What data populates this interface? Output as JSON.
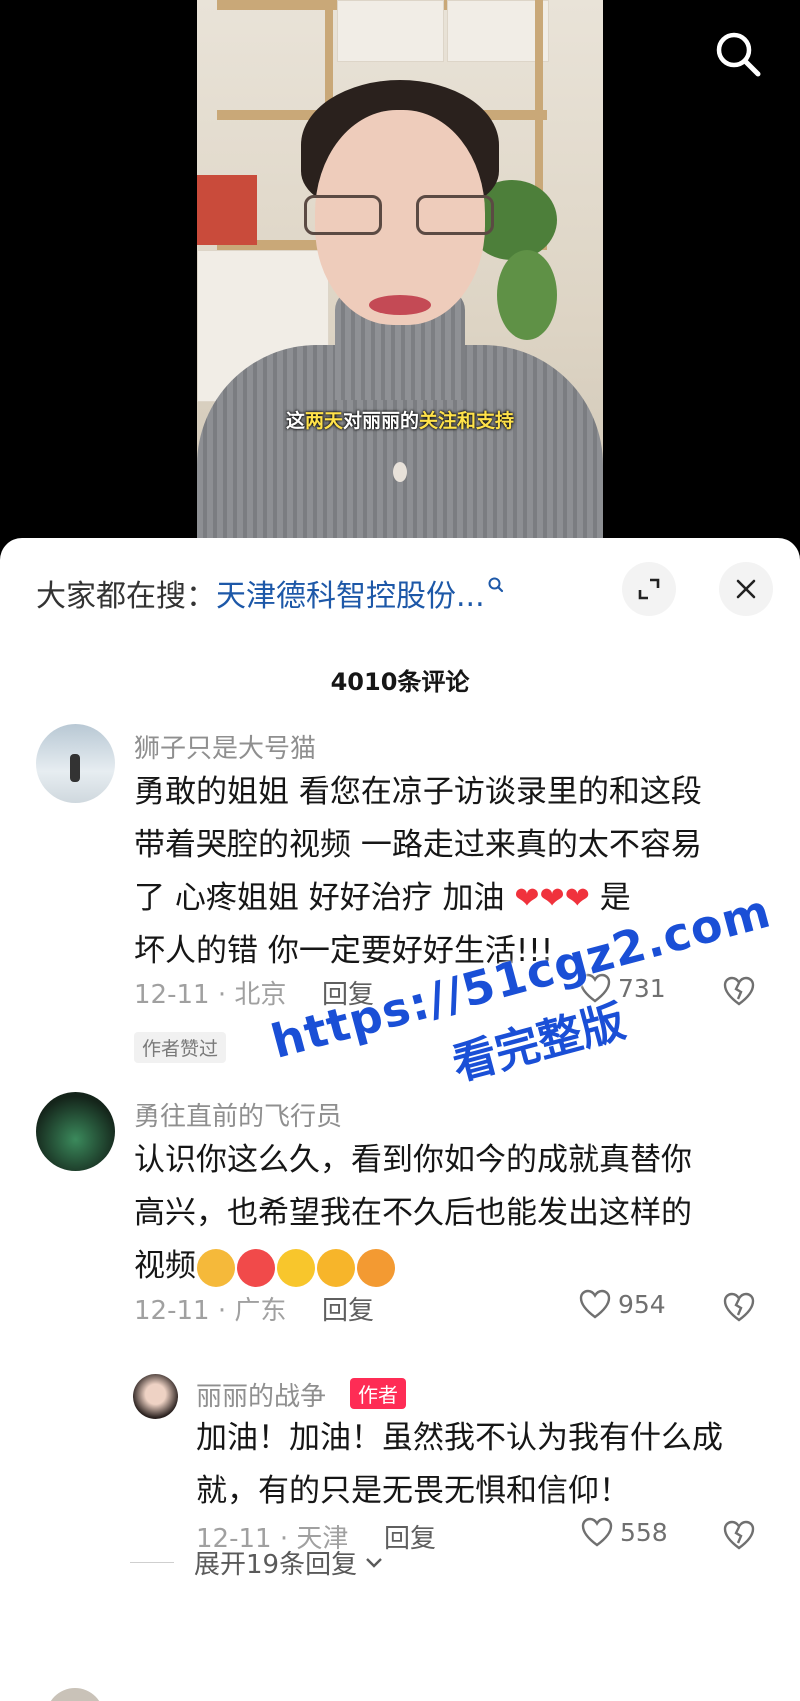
{
  "video": {
    "subtitle_pre": "这",
    "subtitle_hl1": "两天",
    "subtitle_mid": "对丽丽的",
    "subtitle_hl2": "关注和支持",
    "search_icon": "search-icon"
  },
  "sheet": {
    "hot_search_prefix": "大家都在搜：",
    "hot_search_query": "天津德科智控股份...",
    "expand_icon": "expand-icon",
    "close_icon": "close-icon",
    "comment_count": "4010条评论"
  },
  "comments": [
    {
      "user": "狮子只是大号猫",
      "lines": [
        "勇敢的姐姐  看您在凉子访谈录里的和这段",
        "带着哭腔的视频  一路走过来真的太不容易",
        "了  心疼姐姐  好好治疗  加油 ",
        "坏人的错 你一定要好好生活!!!"
      ],
      "line3_hearts": "❤❤❤",
      "line3_tail": " 是",
      "date_location": "12-11 · 北京",
      "reply_label": "回复",
      "likes": "731",
      "badge": "作者赞过"
    },
    {
      "user": "勇往直前的飞行员",
      "lines": [
        "认识你这么久，看到你如今的成就真替你",
        "高兴，也希望我在不久后也能发出这样的",
        "视频"
      ],
      "emoji_names": [
        "pray-emoji",
        "jiayou-emoji",
        "muscle-emoji",
        "heart-hands-emoji",
        "hufen-emoji"
      ],
      "date_location": "12-11 · 广东",
      "reply_label": "回复",
      "likes": "954"
    },
    {
      "user": "丽丽的战争",
      "author_tag": "作者",
      "lines": [
        "加油！加油！虽然我不认为我有什么成",
        "就，有的只是无畏无惧和信仰！"
      ],
      "date_location": "12-11 · 天津",
      "reply_label": "回复",
      "likes": "558"
    }
  ],
  "expand_replies": "展开19条回复",
  "watermark": {
    "url": "https://51cgz2.com",
    "text": "看完整版"
  },
  "colors": {
    "accent": "#fe2c55",
    "link": "#1d58a8",
    "watermark": "#1a4fd6"
  }
}
